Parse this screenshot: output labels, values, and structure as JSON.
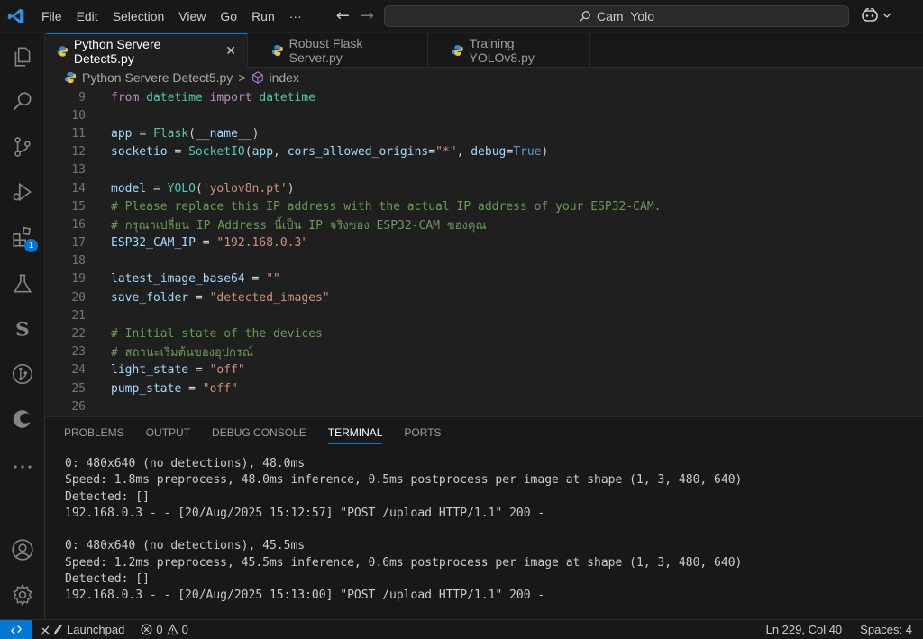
{
  "titlebar": {
    "menu": [
      "File",
      "Edit",
      "Selection",
      "View",
      "Go",
      "Run"
    ],
    "more": "···",
    "search_text": "Cam_Yolo"
  },
  "activity_bar": {
    "extensions_badge": "1"
  },
  "tabs": [
    {
      "label": "Python Servere Detect5.py",
      "active": true
    },
    {
      "label": "Robust Flask Server.py",
      "active": false
    },
    {
      "label": "Training YOLOv8.py",
      "active": false
    }
  ],
  "breadcrumb": {
    "file": "Python Servere Detect5.py",
    "separator": ">",
    "symbol": "index"
  },
  "editor": {
    "lines": [
      {
        "n": "9",
        "text": "from datetime import datetime"
      },
      {
        "n": "10",
        "text": ""
      },
      {
        "n": "11",
        "text": "app = Flask(__name__)"
      },
      {
        "n": "12",
        "text": "socketio = SocketIO(app, cors_allowed_origins=\"*\", debug=True)"
      },
      {
        "n": "13",
        "text": ""
      },
      {
        "n": "14",
        "text": "model = YOLO('yolov8n.pt')"
      },
      {
        "n": "15",
        "text": "# Please replace this IP address with the actual IP address of your ESP32-CAM."
      },
      {
        "n": "16",
        "text": "# กรุณาเปลี่ยน IP Address นี้เป็น IP จริงของ ESP32-CAM ของคุณ"
      },
      {
        "n": "17",
        "text": "ESP32_CAM_IP = \"192.168.0.3\""
      },
      {
        "n": "18",
        "text": ""
      },
      {
        "n": "19",
        "text": "latest_image_base64 = \"\""
      },
      {
        "n": "20",
        "text": "save_folder = \"detected_images\""
      },
      {
        "n": "21",
        "text": ""
      },
      {
        "n": "22",
        "text": "# Initial state of the devices"
      },
      {
        "n": "23",
        "text": "# สถานะเริ่มต้นของอุปกรณ์"
      },
      {
        "n": "24",
        "text": "light_state = \"off\""
      },
      {
        "n": "25",
        "text": "pump_state = \"off\""
      },
      {
        "n": "26",
        "text": ""
      }
    ]
  },
  "panel": {
    "tabs": [
      {
        "label": "PROBLEMS",
        "active": false
      },
      {
        "label": "OUTPUT",
        "active": false
      },
      {
        "label": "DEBUG CONSOLE",
        "active": false
      },
      {
        "label": "TERMINAL",
        "active": true
      },
      {
        "label": "PORTS",
        "active": false
      }
    ],
    "terminal_lines": [
      "0: 480x640 (no detections), 48.0ms",
      "Speed: 1.8ms preprocess, 48.0ms inference, 0.5ms postprocess per image at shape (1, 3, 480, 640)",
      "Detected: []",
      "192.168.0.3 - - [20/Aug/2025 15:12:57] \"POST /upload HTTP/1.1\" 200 -",
      "",
      "0: 480x640 (no detections), 45.5ms",
      "Speed: 1.2ms preprocess, 45.5ms inference, 0.6ms postprocess per image at shape (1, 3, 480, 640)",
      "Detected: []",
      "192.168.0.3 - - [20/Aug/2025 15:13:00] \"POST /upload HTTP/1.1\" 200 -"
    ]
  },
  "statusbar": {
    "launchpad": "Launchpad",
    "errors": "0",
    "warnings": "0",
    "position": "Ln 229, Col 40",
    "spaces": "Spaces: 4"
  }
}
